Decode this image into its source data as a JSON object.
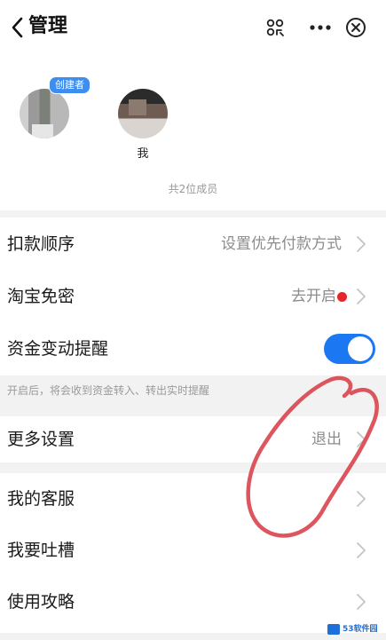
{
  "header": {
    "title": "管理",
    "back_icon": "chevron-left-icon",
    "scan_icon": "scan-icon",
    "more_icon": "more-dots-icon",
    "close_icon": "close-circle-icon"
  },
  "members": {
    "list": [
      {
        "name": "",
        "badge": "创建者"
      },
      {
        "name": "我",
        "badge": ""
      }
    ],
    "count_text": "共2位成员"
  },
  "settings": {
    "payment_order": {
      "label": "扣款顺序",
      "value": "设置优先付款方式"
    },
    "taobao": {
      "label": "淘宝免密",
      "value": "去开启"
    },
    "fund_alert": {
      "label": "资金变动提醒",
      "enabled": true,
      "hint": "开启后，将会收到资金转入、转出实时提醒"
    },
    "more": {
      "label": "更多设置",
      "value": "退出"
    }
  },
  "support": {
    "service": {
      "label": "我的客服"
    },
    "feedback": {
      "label": "我要吐槽"
    },
    "guide": {
      "label": "使用攻略"
    }
  },
  "colors": {
    "accent": "#1c77f2",
    "badge": "#3d8ef0",
    "red_dot": "#e6262c",
    "annotation": "#d9434d"
  },
  "watermark": {
    "text": "53软件园"
  }
}
